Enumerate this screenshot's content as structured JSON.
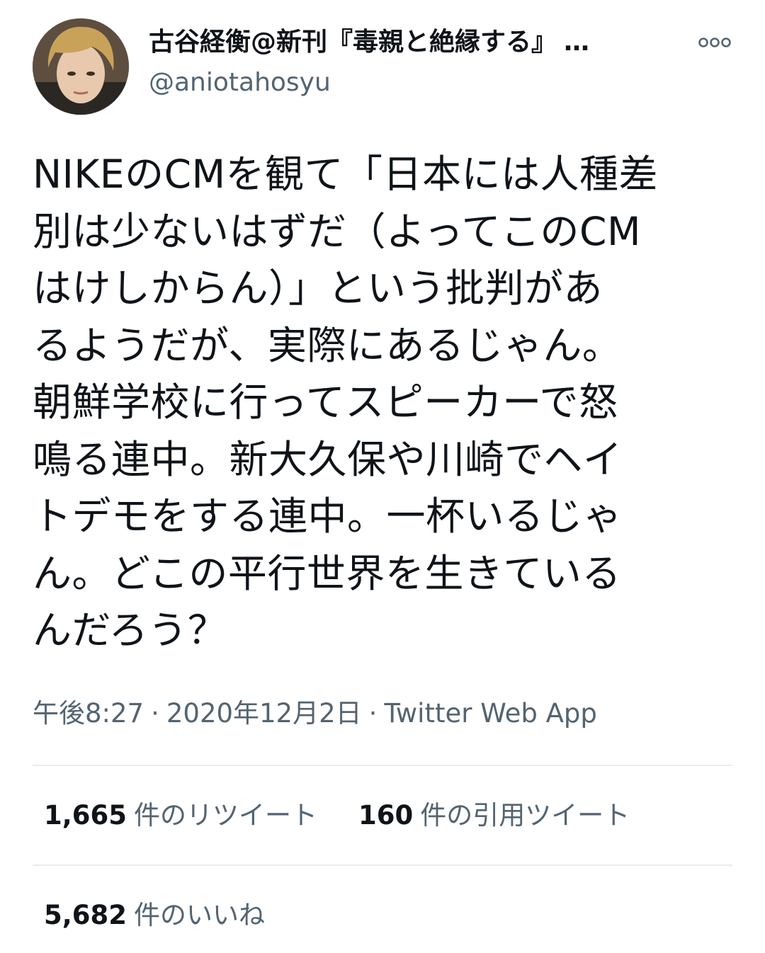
{
  "tweet": {
    "author": {
      "display_name": "古谷経衡@新刊『毒親と絶縁する』",
      "ellipsis": "…",
      "handle": "@aniotahosyu",
      "avatar_icon": "avatar-photo"
    },
    "more_icon": "more-dots-icon",
    "text_lines": [
      "NIKEのCMを観て「日本には人種差",
      "別は少ないはずだ（よってこのCM",
      "はけしからん）」という批判があ",
      "るようだが、実際にあるじゃん。",
      "朝鮮学校に行ってスピーカーで怒",
      "鳴る連中。新大久保や川崎でヘイ",
      "トデモをする連中。一杯いるじゃ",
      "ん。どこの平行世界を生きている",
      "んだろう？"
    ],
    "time": "午後8:27",
    "separator": "·",
    "date": "2020年12月2日",
    "source": "Twitter Web App",
    "stats": {
      "retweets_count": "1,665",
      "retweets_label": "件のリツイート",
      "quotes_count": "160",
      "quotes_label": "件の引用ツイート",
      "likes_count": "5,682",
      "likes_label": "件のいいね"
    }
  },
  "colors": {
    "text_primary": "#0f1419",
    "text_secondary": "#536471",
    "divider": "#e6ecf0"
  }
}
